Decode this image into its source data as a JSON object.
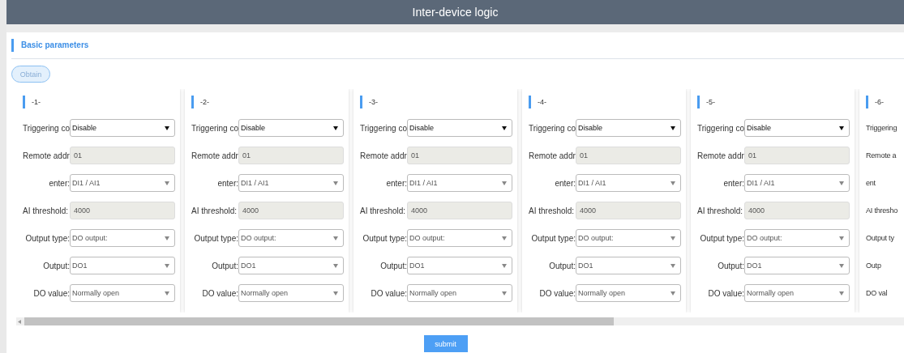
{
  "window": {
    "title": "Inter-device logic"
  },
  "section": {
    "title": "Basic parameters"
  },
  "obtain_button": "Obtain",
  "cards": [
    {
      "title": "-1-",
      "fields": [
        {
          "label": "Triggering co",
          "kind": "select",
          "value": "Disable",
          "disabled": false
        },
        {
          "label": "Remote addr",
          "kind": "input",
          "value": "01",
          "disabled": true
        },
        {
          "label": "enter:",
          "kind": "select",
          "value": "DI1 / AI1",
          "disabled": true
        },
        {
          "label": "AI threshold:",
          "kind": "input",
          "value": "4000",
          "disabled": true
        },
        {
          "label": "Output type:",
          "kind": "select",
          "value": "DO output:",
          "disabled": true
        },
        {
          "label": "Output:",
          "kind": "select",
          "value": "DO1",
          "disabled": true
        },
        {
          "label": "DO value:",
          "kind": "select",
          "value": "Normally open",
          "disabled": true
        }
      ]
    },
    {
      "title": "-2-",
      "fields": [
        {
          "label": "Triggering co",
          "kind": "select",
          "value": "Disable",
          "disabled": false
        },
        {
          "label": "Remote addr",
          "kind": "input",
          "value": "01",
          "disabled": true
        },
        {
          "label": "enter:",
          "kind": "select",
          "value": "DI1 / AI1",
          "disabled": true
        },
        {
          "label": "AI threshold:",
          "kind": "input",
          "value": "4000",
          "disabled": true
        },
        {
          "label": "Output type:",
          "kind": "select",
          "value": "DO output:",
          "disabled": true
        },
        {
          "label": "Output:",
          "kind": "select",
          "value": "DO1",
          "disabled": true
        },
        {
          "label": "DO value:",
          "kind": "select",
          "value": "Normally open",
          "disabled": true
        }
      ]
    },
    {
      "title": "-3-",
      "fields": [
        {
          "label": "Triggering co",
          "kind": "select",
          "value": "Disable",
          "disabled": false
        },
        {
          "label": "Remote addr",
          "kind": "input",
          "value": "01",
          "disabled": true
        },
        {
          "label": "enter:",
          "kind": "select",
          "value": "DI1 / AI1",
          "disabled": true
        },
        {
          "label": "AI threshold:",
          "kind": "input",
          "value": "4000",
          "disabled": true
        },
        {
          "label": "Output type:",
          "kind": "select",
          "value": "DO output:",
          "disabled": true
        },
        {
          "label": "Output:",
          "kind": "select",
          "value": "DO1",
          "disabled": true
        },
        {
          "label": "DO value:",
          "kind": "select",
          "value": "Normally open",
          "disabled": true
        }
      ]
    },
    {
      "title": "-4-",
      "fields": [
        {
          "label": "Triggering co",
          "kind": "select",
          "value": "Disable",
          "disabled": false
        },
        {
          "label": "Remote addr",
          "kind": "input",
          "value": "01",
          "disabled": true
        },
        {
          "label": "enter:",
          "kind": "select",
          "value": "DI1 / AI1",
          "disabled": true
        },
        {
          "label": "AI threshold:",
          "kind": "input",
          "value": "4000",
          "disabled": true
        },
        {
          "label": "Output type:",
          "kind": "select",
          "value": "DO output:",
          "disabled": true
        },
        {
          "label": "Output:",
          "kind": "select",
          "value": "DO1",
          "disabled": true
        },
        {
          "label": "DO value:",
          "kind": "select",
          "value": "Normally open",
          "disabled": true
        }
      ]
    },
    {
      "title": "-5-",
      "fields": [
        {
          "label": "Triggering co",
          "kind": "select",
          "value": "Disable",
          "disabled": false
        },
        {
          "label": "Remote addr",
          "kind": "input",
          "value": "01",
          "disabled": true
        },
        {
          "label": "enter:",
          "kind": "select",
          "value": "DI1 / AI1",
          "disabled": true
        },
        {
          "label": "AI threshold:",
          "kind": "input",
          "value": "4000",
          "disabled": true
        },
        {
          "label": "Output type:",
          "kind": "select",
          "value": "DO output:",
          "disabled": true
        },
        {
          "label": "Output:",
          "kind": "select",
          "value": "DO1",
          "disabled": true
        },
        {
          "label": "DO value:",
          "kind": "select",
          "value": "Normally open",
          "disabled": true
        }
      ]
    },
    {
      "title": "-6-",
      "fields": [
        {
          "label": "Triggering",
          "kind": "label"
        },
        {
          "label": "Remote a",
          "kind": "label"
        },
        {
          "label": "ent",
          "kind": "label"
        },
        {
          "label": "AI thresho",
          "kind": "label"
        },
        {
          "label": "Output ty",
          "kind": "label"
        },
        {
          "label": "Outp",
          "kind": "label"
        },
        {
          "label": "DO val",
          "kind": "label"
        }
      ]
    }
  ],
  "submit_button": "submit"
}
